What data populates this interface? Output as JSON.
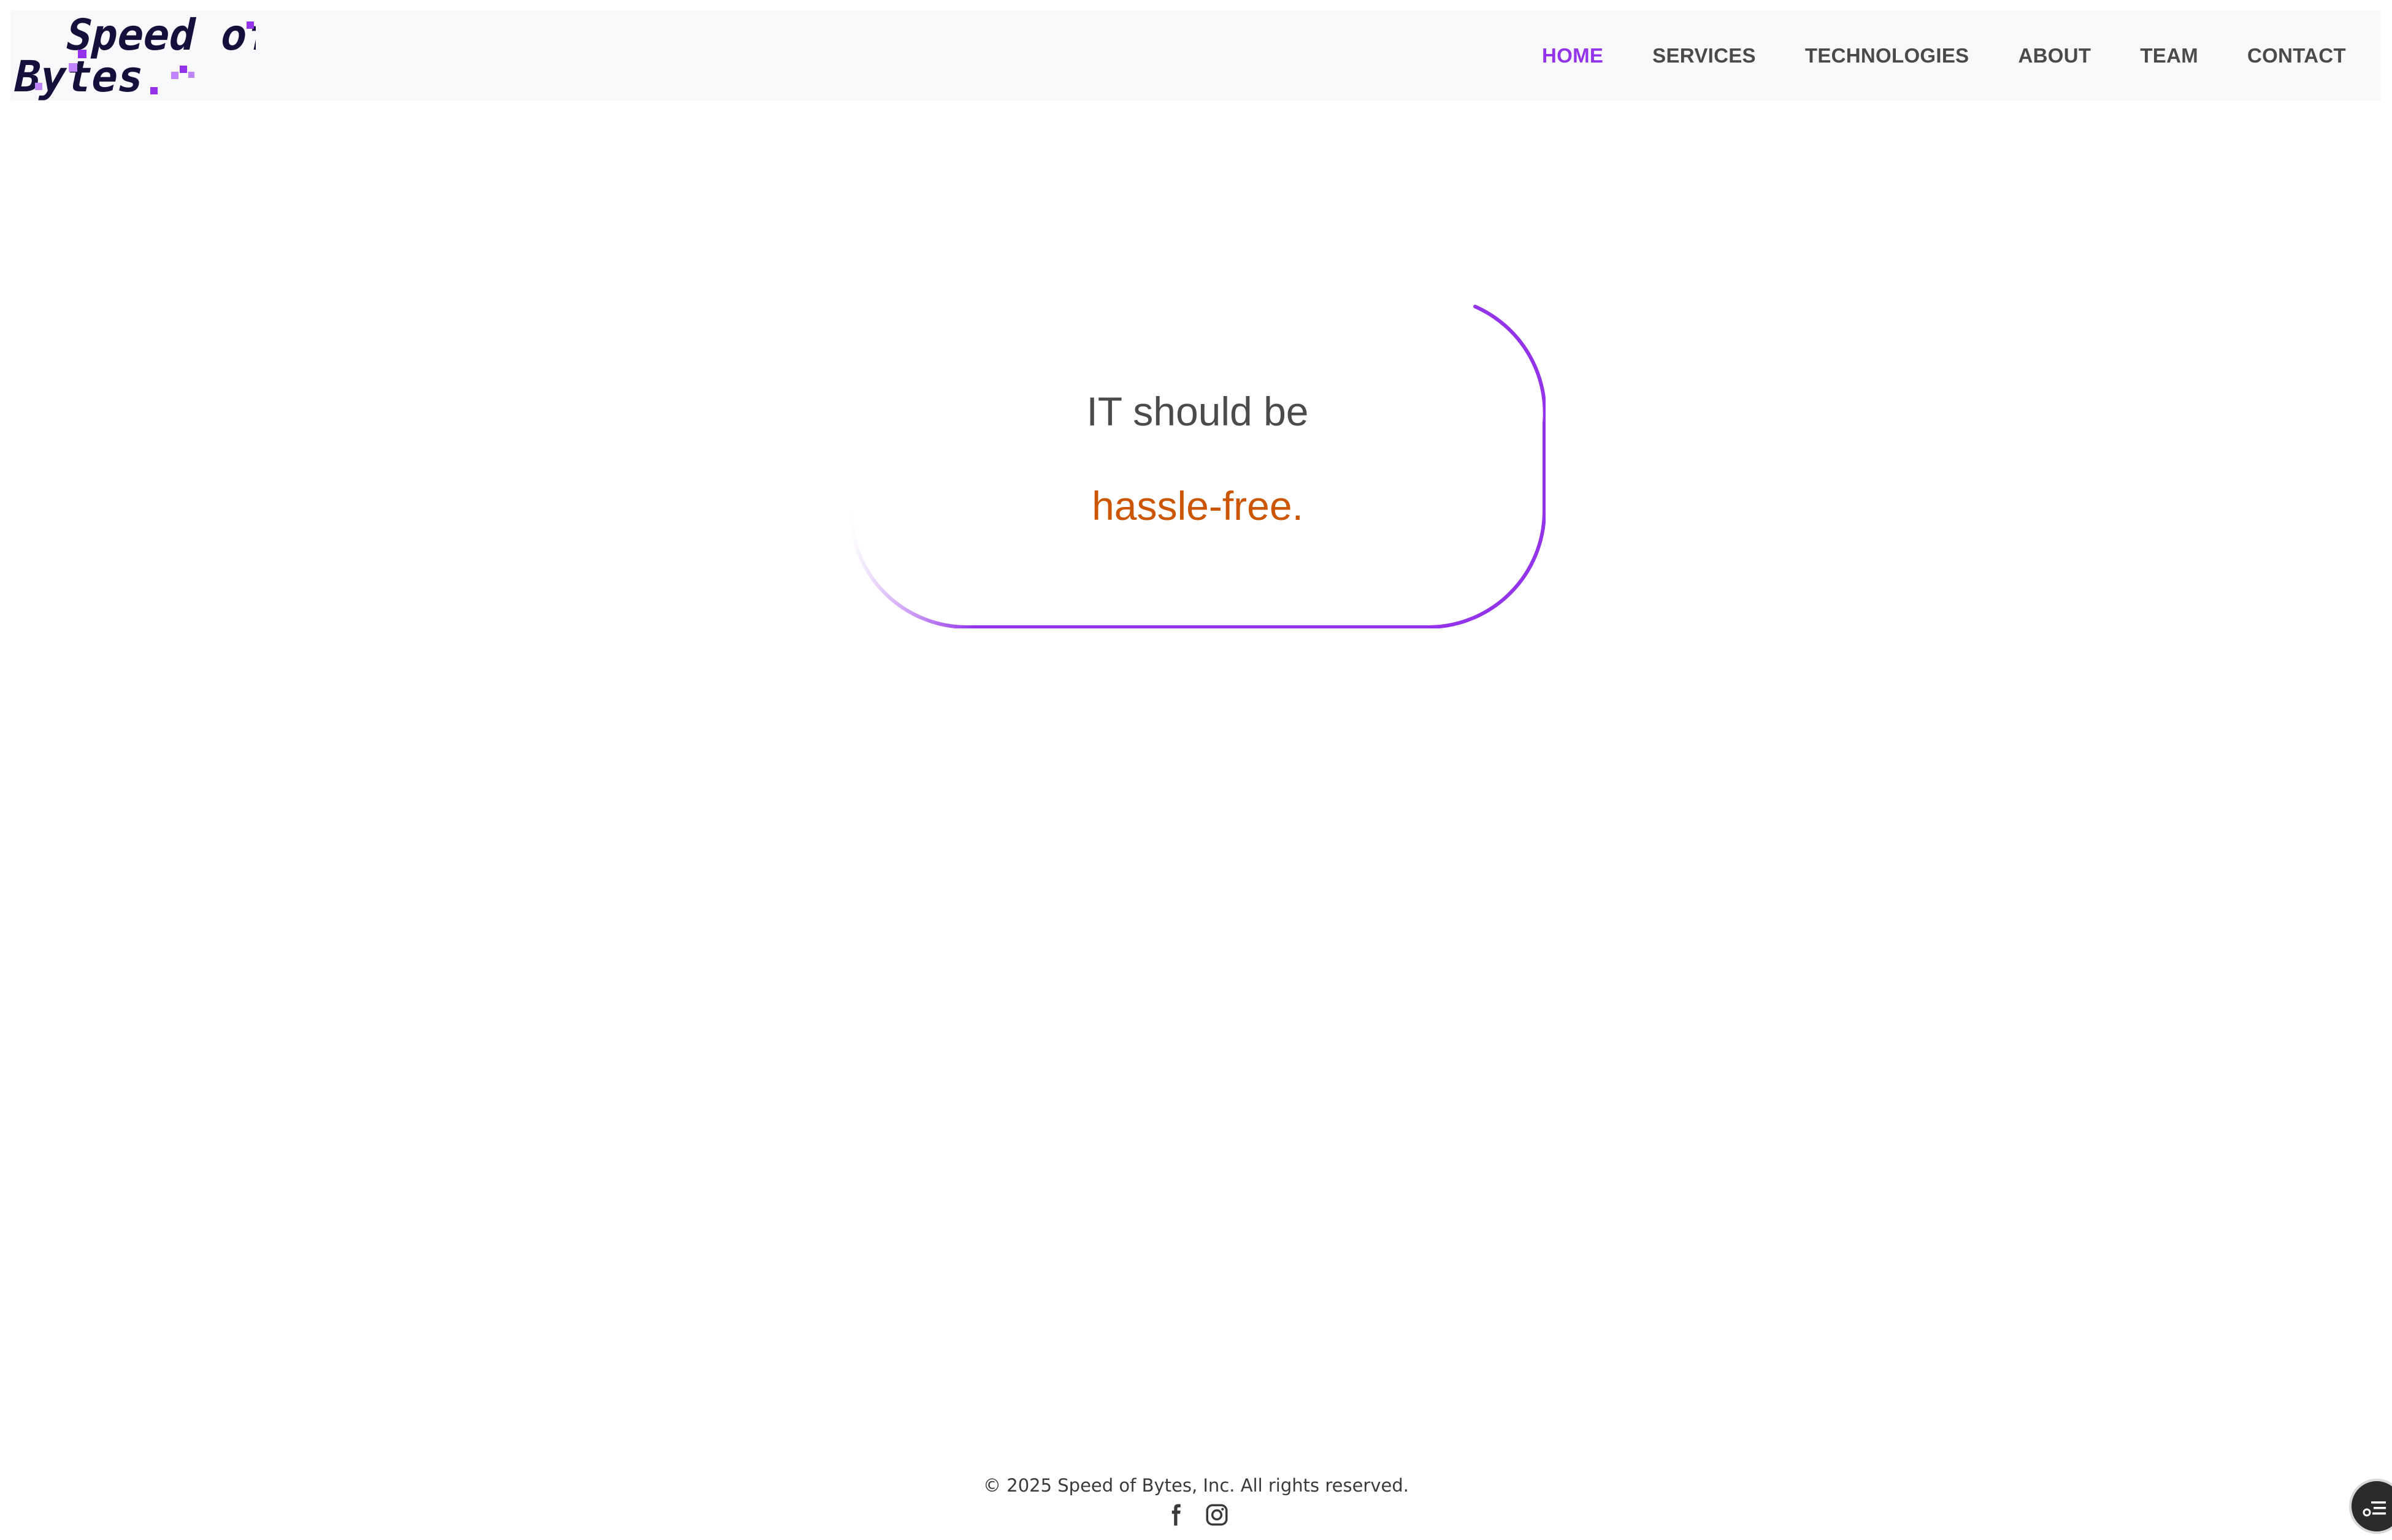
{
  "header": {
    "logo": {
      "line1": "Speed of",
      "line2": "Bytes",
      "colors": {
        "text": "#14103c",
        "accent": "#9333ea",
        "accent_light": "#c084fc"
      }
    },
    "nav": [
      {
        "label": "HOME",
        "active": true
      },
      {
        "label": "SERVICES",
        "active": false
      },
      {
        "label": "TECHNOLOGIES",
        "active": false
      },
      {
        "label": "ABOUT",
        "active": false
      },
      {
        "label": "TEAM",
        "active": false
      },
      {
        "label": "CONTACT",
        "active": false
      }
    ]
  },
  "hero": {
    "line1": "IT should be",
    "line2": "hassle-free."
  },
  "footer": {
    "copyright": "© 2025 Speed of Bytes, Inc. All rights reserved.",
    "social_icons": [
      "facebook-icon",
      "instagram-icon"
    ]
  },
  "floating_widget": {
    "icon": "accessibility-menu-icon"
  },
  "colors": {
    "accent": "#9333ea",
    "highlight": "#cc5500",
    "nav_text": "#4a4a4a",
    "header_bg": "#f9f9fb",
    "body_text": "#4b4b4b"
  }
}
